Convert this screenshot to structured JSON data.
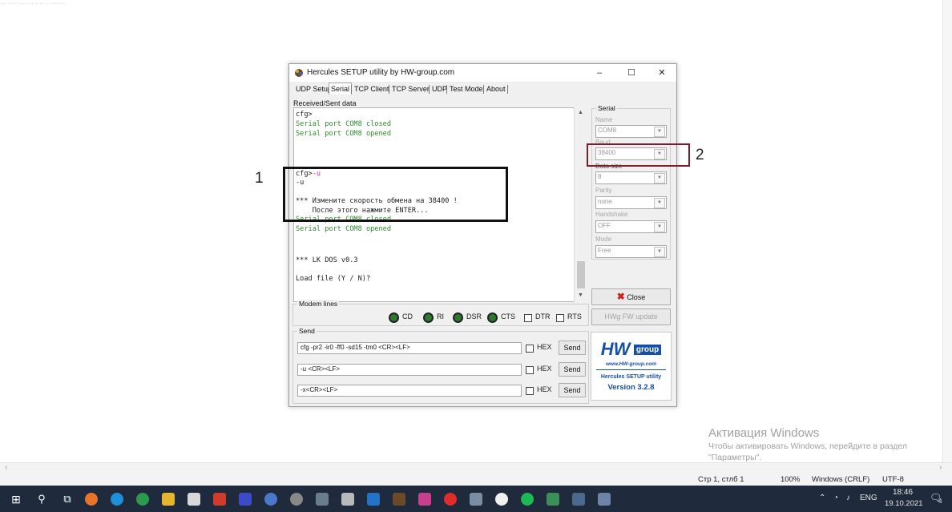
{
  "window": {
    "title": "Hercules SETUP utility by HW-group.com",
    "minimize": "–",
    "maximize": "☐",
    "close": "✕"
  },
  "tabs": [
    "UDP Setup",
    "Serial",
    "TCP Client",
    "TCP Server",
    "UDP",
    "Test Mode",
    "About"
  ],
  "received_label": "Received/Sent data",
  "received_lines": [
    {
      "parts": [
        {
          "t": "cfg>",
          "c": "black"
        }
      ]
    },
    {
      "parts": [
        {
          "t": "Serial port COM8 closed",
          "c": "green"
        }
      ]
    },
    {
      "parts": [
        {
          "t": "Serial port COM8 opened",
          "c": "green"
        }
      ]
    },
    {
      "parts": [
        {
          "t": "cfg>",
          "c": "black"
        },
        {
          "t": "-u",
          "c": "pink"
        }
      ]
    },
    {
      "parts": [
        {
          "t": "-u",
          "c": "black"
        }
      ]
    },
    {
      "parts": [
        {
          "t": "*** Измените скорость обмена на 38400 !",
          "c": "black"
        }
      ]
    },
    {
      "parts": [
        {
          "t": "    После этого нажмите ENTER...",
          "c": "black"
        }
      ]
    },
    {
      "parts": [
        {
          "t": "Serial port COM8 closed",
          "c": "green"
        }
      ]
    },
    {
      "parts": [
        {
          "t": "Serial port COM8 opened",
          "c": "green"
        }
      ]
    },
    {
      "parts": [
        {
          "t": "*** LK DOS v0.3",
          "c": "black"
        }
      ]
    },
    {
      "parts": [
        {
          "t": "Load file (Y / N)?",
          "c": "black"
        }
      ]
    }
  ],
  "serial": {
    "group_label": "Serial",
    "name_label": "Name",
    "name_value": "COM8",
    "baud_label": "Baud",
    "baud_value": "38400",
    "datasize_label": "Data size",
    "datasize_value": "8",
    "parity_label": "Parity",
    "parity_value": "none",
    "handshake_label": "Handshake",
    "handshake_value": "OFF",
    "mode_label": "Mode",
    "mode_value": "Free",
    "close_button": "Close",
    "fw_button": "HWg FW update"
  },
  "modem": {
    "label": "Modem lines",
    "leds": [
      "CD",
      "RI",
      "DSR",
      "CTS"
    ],
    "checks": [
      "DTR",
      "RTS"
    ]
  },
  "send": {
    "label": "Send",
    "rows": [
      {
        "value": "cfg -pr2 -ir0 -ff0 -sd15 -tm0 <CR><LF>",
        "hex": "HEX",
        "button": "Send"
      },
      {
        "value": "-u <CR><LF>",
        "hex": "HEX",
        "button": "Send"
      },
      {
        "value": "-x<CR><LF>",
        "hex": "HEX",
        "button": "Send"
      }
    ]
  },
  "logo": {
    "brand": "HW",
    "group": "group",
    "url": "www.HW-group.com",
    "product": "Hercules SETUP utility",
    "version": "Version  3.2.8"
  },
  "annotations": {
    "one": "1",
    "two": "2"
  },
  "colors": {
    "annotation1": "#111111",
    "annotation2": "#7b1c2c",
    "log_green": "#2e8b2e",
    "log_pink": "#c42abe",
    "taskbar": "#1f2b3c"
  },
  "activation": {
    "title": "Активация Windows",
    "text1": "Чтобы активировать Windows, перейдите в раздел",
    "text2": "\"Параметры\"."
  },
  "statusbar": {
    "position": "Стр 1, стлб 1",
    "zoom": "100%",
    "line_ending": "Windows (CRLF)",
    "encoding": "UTF-8"
  },
  "taskbar": {
    "lang": "ENG",
    "time": "18:46",
    "date": "19.10.2021",
    "notifications": "4"
  }
}
